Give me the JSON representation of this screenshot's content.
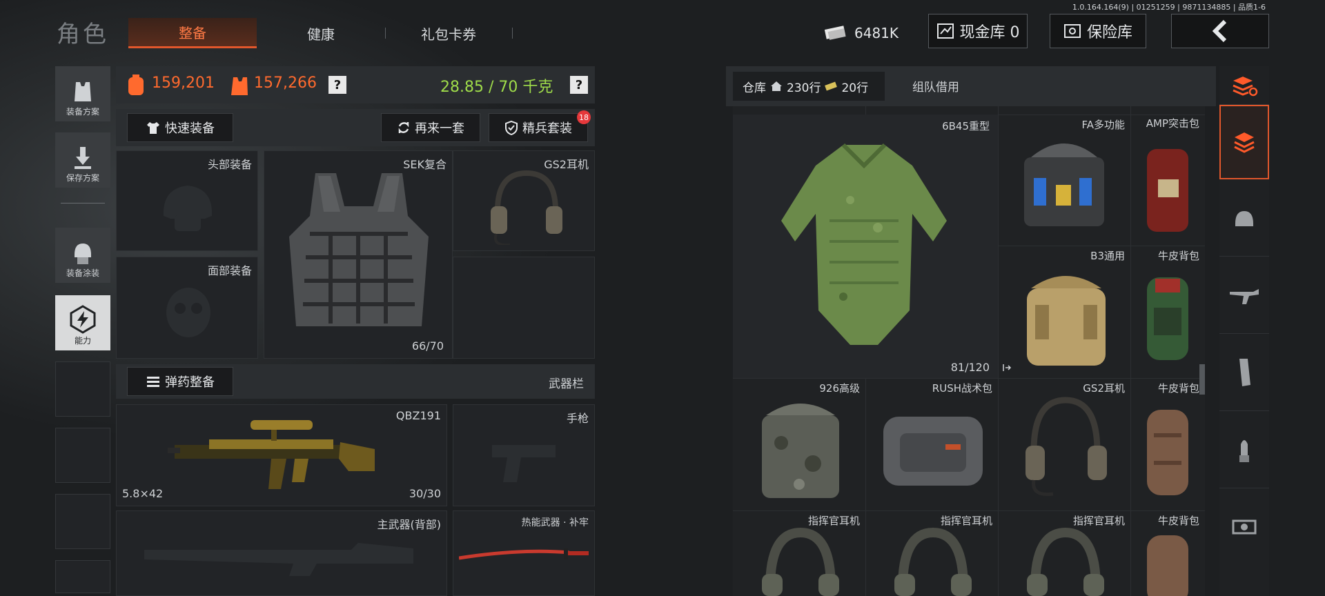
{
  "version": "1.0.164.164(9) | 01251259 | 9871134885 | 品质1-6",
  "header": {
    "title": "角色",
    "tabs": [
      {
        "label": "整备",
        "active": true
      },
      {
        "label": "健康",
        "active": false
      },
      {
        "label": "礼包卡券",
        "active": false
      }
    ],
    "currency": "6481K",
    "cash_vault": "现金库 0",
    "insurance_vault": "保险库",
    "back_icon": "chevron-left-icon"
  },
  "sidebar": {
    "items": [
      {
        "label": "装备方案",
        "icon": "vest-icon"
      },
      {
        "label": "保存方案",
        "icon": "download-icon"
      },
      {
        "label": "装备涂装",
        "icon": "helmet-icon"
      },
      {
        "label": "能力",
        "icon": "lightning-icon",
        "active": true
      }
    ]
  },
  "stats": {
    "value_1": "159,201",
    "value_2": "157,266",
    "help_1": "?",
    "weight": "28.85 / 70 千克",
    "help_2": "?"
  },
  "actions": {
    "quick_equip": "快速装备",
    "reequip": "再来一套",
    "elite_set": "精兵套装",
    "elite_badge": "18"
  },
  "slots": {
    "head": "头部装备",
    "face": "面部装备",
    "armor": "SEK复合",
    "armor_durability": "66/70",
    "headset": "GS2耳机",
    "ammo_button": "弹药整备",
    "weapon_bar": "武器栏",
    "primary": "QBZ191",
    "primary_caliber": "5.8×42",
    "primary_ammo": "30/30",
    "pistol": "手枪",
    "back_weapon": "主武器(背部)",
    "melee": "热能武器 · 补牢"
  },
  "warehouse": {
    "tab_label": "仓库",
    "rows_icon": "home-icon",
    "rows": "230行",
    "ticket_icon": "ticket-icon",
    "tickets": "20行",
    "team_borrow": "组队借用",
    "items": [
      {
        "name": "6B45重型",
        "extra": "81/120"
      },
      {
        "name": "FA多功能"
      },
      {
        "name": "AMP突击包"
      },
      {
        "name": "B3通用"
      },
      {
        "name": "牛皮背包"
      },
      {
        "name": "926高级"
      },
      {
        "name": "RUSH战术包"
      },
      {
        "name": "GS2耳机"
      },
      {
        "name": "牛皮背包"
      },
      {
        "name": "指挥官耳机"
      },
      {
        "name": "指挥官耳机"
      },
      {
        "name": "指挥官耳机"
      },
      {
        "name": "牛皮背包"
      }
    ]
  },
  "colors": {
    "accent": "#e2572c",
    "weight_green": "#9fdc4a",
    "orange_text": "#ff6a2e"
  }
}
